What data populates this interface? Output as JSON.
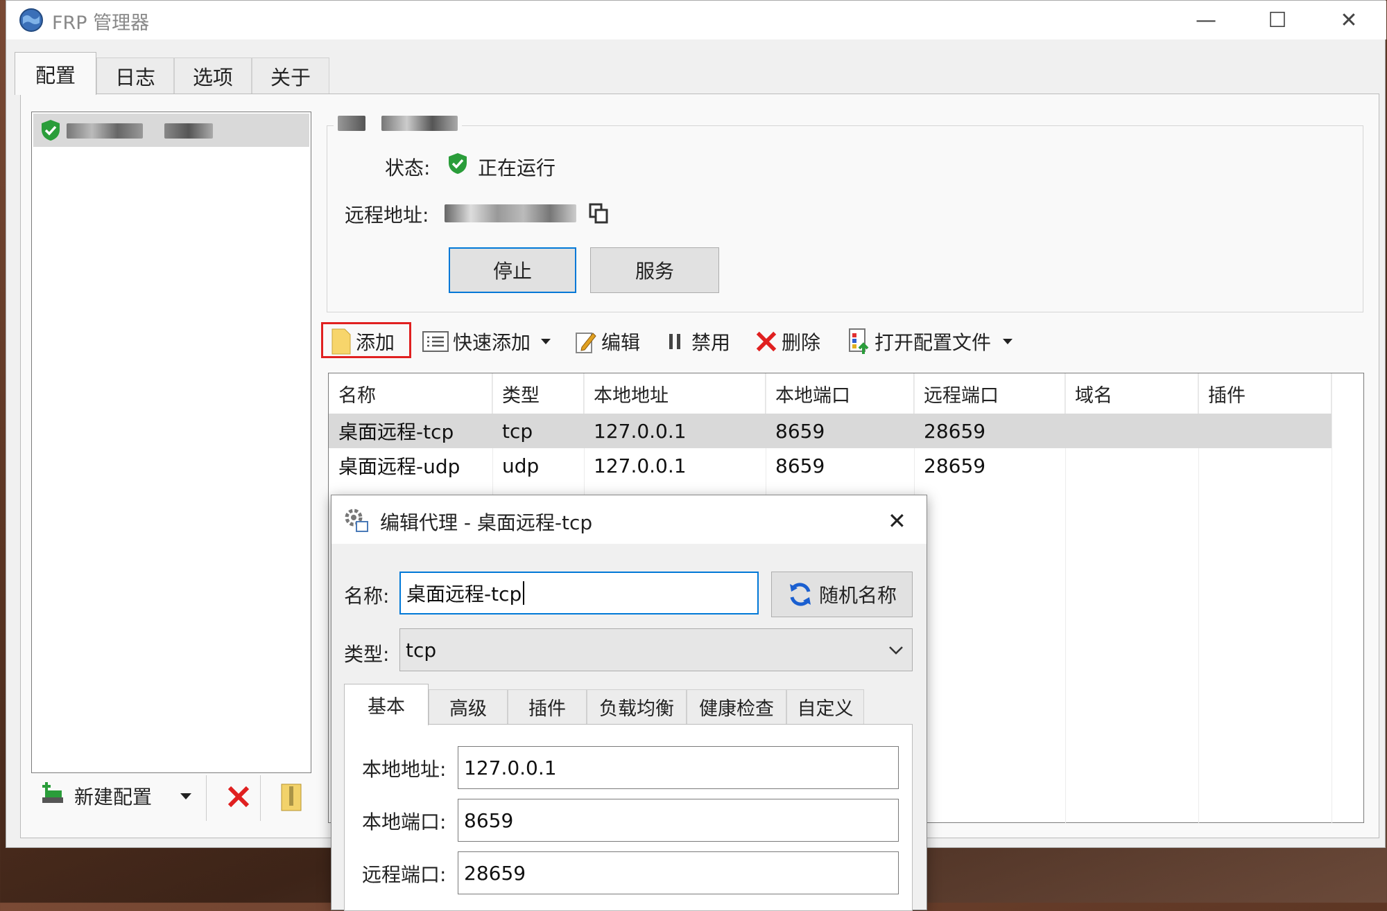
{
  "window": {
    "title": "FRP 管理器",
    "controls": {
      "minimize": "—",
      "maximize": "☐",
      "close": "✕"
    }
  },
  "tabs": [
    "配置",
    "日志",
    "选项",
    "关于"
  ],
  "left_panel": {
    "bottom": {
      "new_config": "新建配置"
    }
  },
  "detail": {
    "status_label": "状态:",
    "status_value": "正在运行",
    "remote_label": "远程地址:",
    "stop_button": "停止",
    "service_button": "服务"
  },
  "toolbar": {
    "add": "添加",
    "quick_add": "快速添加",
    "edit": "编辑",
    "disable": "禁用",
    "delete": "删除",
    "open_config": "打开配置文件"
  },
  "table": {
    "headers": [
      "名称",
      "类型",
      "本地地址",
      "本地端口",
      "远程端口",
      "域名",
      "插件"
    ],
    "rows": [
      [
        "桌面远程-tcp",
        "tcp",
        "127.0.0.1",
        "8659",
        "28659",
        "",
        ""
      ],
      [
        "桌面远程-udp",
        "udp",
        "127.0.0.1",
        "8659",
        "28659",
        "",
        ""
      ]
    ]
  },
  "dialog": {
    "title": "编辑代理 - 桌面远程-tcp",
    "name_label": "名称:",
    "name_value": "桌面远程-tcp",
    "random_button": "随机名称",
    "type_label": "类型:",
    "type_value": "tcp",
    "tabs": [
      "基本",
      "高级",
      "插件",
      "负载均衡",
      "健康检查",
      "自定义"
    ],
    "fields": [
      {
        "label": "本地地址:",
        "value": "127.0.0.1"
      },
      {
        "label": "本地端口:",
        "value": "8659"
      },
      {
        "label": "远程端口:",
        "value": "28659"
      }
    ]
  },
  "colors": {
    "accent": "#0078d7",
    "status_green": "#2a9d3a",
    "delete_red": "#e02020",
    "highlight_box": "#e02020"
  }
}
